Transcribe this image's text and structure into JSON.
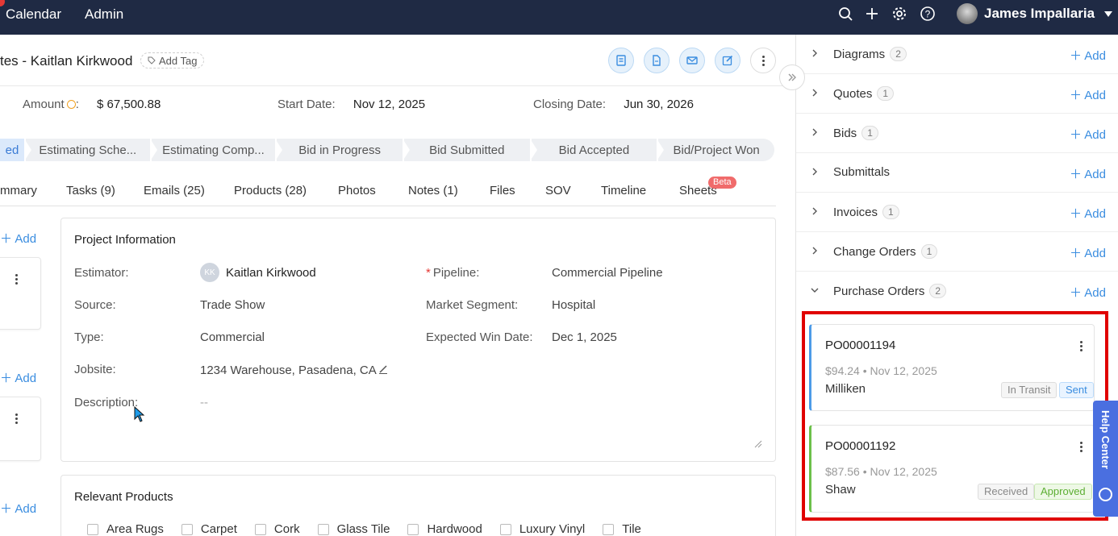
{
  "topbar": {
    "nav": [
      "Calendar",
      "Admin"
    ],
    "user_name": "James Impallaria",
    "icons": [
      "search-icon",
      "plus-icon",
      "gear-icon",
      "help-icon"
    ]
  },
  "header": {
    "title": "tes - Kaitlan Kirkwood",
    "add_tag": "Add Tag",
    "actions": [
      "file-dollar-icon",
      "document-icon",
      "mail-icon",
      "edit-icon",
      "more-icon"
    ]
  },
  "summary": {
    "amount_label": "Amount",
    "amount_suffix": ":",
    "amount_value": "$ 67,500.88",
    "start_label": "Start Date:",
    "start_value": "Nov 12, 2025",
    "closing_label": "Closing Date:",
    "closing_value": "Jun 30, 2026"
  },
  "stages": [
    "ed",
    "Estimating Sche...",
    "Estimating Comp...",
    "Bid in Progress",
    "Bid Submitted",
    "Bid Accepted",
    "Bid/Project Won"
  ],
  "tabs": [
    "mmary",
    "Tasks (9)",
    "Emails (25)",
    "Products (28)",
    "Photos",
    "Notes (1)",
    "Files",
    "SOV",
    "Timeline",
    "Sheets"
  ],
  "tab_badge": "Beta",
  "left_column": {
    "add_label": "Add"
  },
  "project_info": {
    "title": "Project Information",
    "estimator_label": "Estimator:",
    "estimator_initials": "KK",
    "estimator_value": "Kaitlan Kirkwood",
    "pipeline_label": "Pipeline:",
    "pipeline_required": "*",
    "pipeline_value": "Commercial Pipeline",
    "source_label": "Source:",
    "source_value": "Trade Show",
    "segment_label": "Market Segment:",
    "segment_value": "Hospital",
    "type_label": "Type:",
    "type_value": "Commercial",
    "winDate_label": "Expected Win Date:",
    "winDate_value": "Dec 1, 2025",
    "jobsite_label": "Jobsite:",
    "jobsite_value": "1234 Warehouse, Pasadena, CA",
    "description_label": "Description:",
    "description_value": "--"
  },
  "relevant_products": {
    "title": "Relevant Products",
    "items": [
      "Area Rugs",
      "Carpet",
      "Cork",
      "Glass Tile",
      "Hardwood",
      "Luxury Vinyl",
      "Tile"
    ]
  },
  "right_panel": {
    "add_label": "Add",
    "sections": [
      {
        "name": "Diagrams",
        "count": "2"
      },
      {
        "name": "Quotes",
        "count": "1"
      },
      {
        "name": "Bids",
        "count": "1"
      },
      {
        "name": "Submittals",
        "count": ""
      },
      {
        "name": "Invoices",
        "count": "1"
      },
      {
        "name": "Change Orders",
        "count": "1"
      },
      {
        "name": "Purchase Orders",
        "count": "2"
      }
    ],
    "purchase_orders": [
      {
        "number": "PO00001194",
        "meta": "$94.24 • Nov 12, 2025",
        "vendor": "Milliken",
        "tags": [
          "In Transit",
          "Sent"
        ]
      },
      {
        "number": "PO00001192",
        "meta": "$87.56 • Nov 12, 2025",
        "vendor": "Shaw",
        "tags": [
          "Received",
          "Approved"
        ]
      }
    ]
  },
  "help": {
    "label": "Help Center"
  },
  "colors": {
    "topbar": "#1f2a44",
    "accent": "#3a8de0",
    "highlight": "#e00000"
  }
}
